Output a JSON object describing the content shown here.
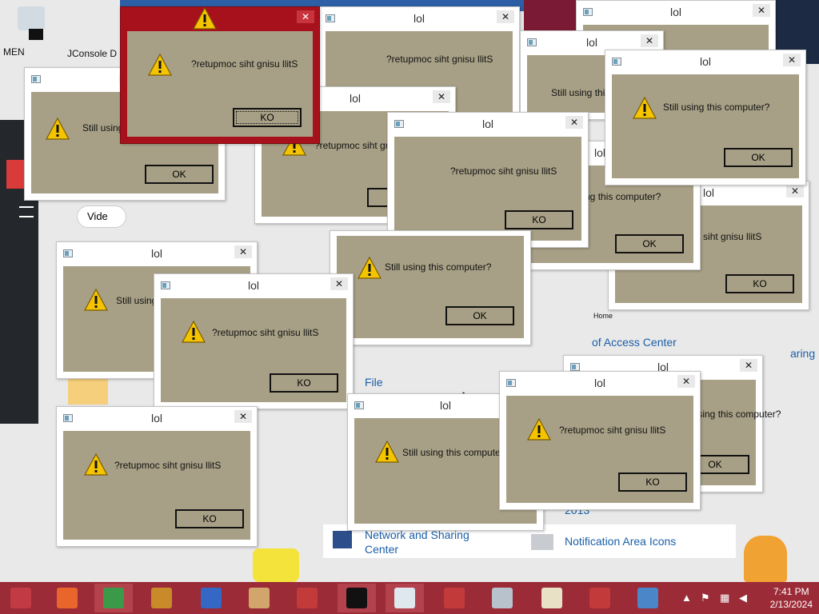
{
  "dialog_title": "lol",
  "msg_forward": "Still using this computer?",
  "msg_reversed": "?retupmoc siht gnisu llitS",
  "btn_ok": "OK",
  "btn_ko": "KO",
  "close_glyph": "✕",
  "background": {
    "menu_text": "MEN",
    "console_text": "JConsole D",
    "video_text": "Vide",
    "sharing_text": "aring",
    "access_center": "of Access Center",
    "file_text": "File",
    "home_text": "Home",
    "network_text": "Network and Sharing Center",
    "notification_text": "Notification Area Icons",
    "year_text": "2013"
  },
  "clock": {
    "time": "7:41 PM",
    "date": "2/13/2024"
  },
  "taskbar_items": [
    {
      "name": "start-orb-icon",
      "color": "#c23a44",
      "open": false
    },
    {
      "name": "firefox-icon",
      "color": "#e8662c",
      "open": false
    },
    {
      "name": "chrome-icon",
      "color": "#3a9a4a",
      "open": true
    },
    {
      "name": "bonzi-icon",
      "color": "#c98a2a",
      "open": false
    },
    {
      "name": "app-icon-1",
      "color": "#3567c4",
      "open": false
    },
    {
      "name": "timmy-icon",
      "color": "#d1a56b",
      "open": false
    },
    {
      "name": "toolbox-icon-1",
      "color": "#c33a3a",
      "open": false
    },
    {
      "name": "cmd-icon",
      "color": "#111111",
      "open": true
    },
    {
      "name": "window-icon",
      "color": "#dfe8ef",
      "open": true
    },
    {
      "name": "toolbox-icon-2",
      "color": "#c33a3a",
      "open": false
    },
    {
      "name": "computer-icon",
      "color": "#b7c2cc",
      "open": false
    },
    {
      "name": "wordpad-icon",
      "color": "#e8e1c5",
      "open": false
    },
    {
      "name": "toolbox-icon-3",
      "color": "#c33a3a",
      "open": false
    },
    {
      "name": "control-panel-icon",
      "color": "#4a86c8",
      "open": false
    }
  ]
}
